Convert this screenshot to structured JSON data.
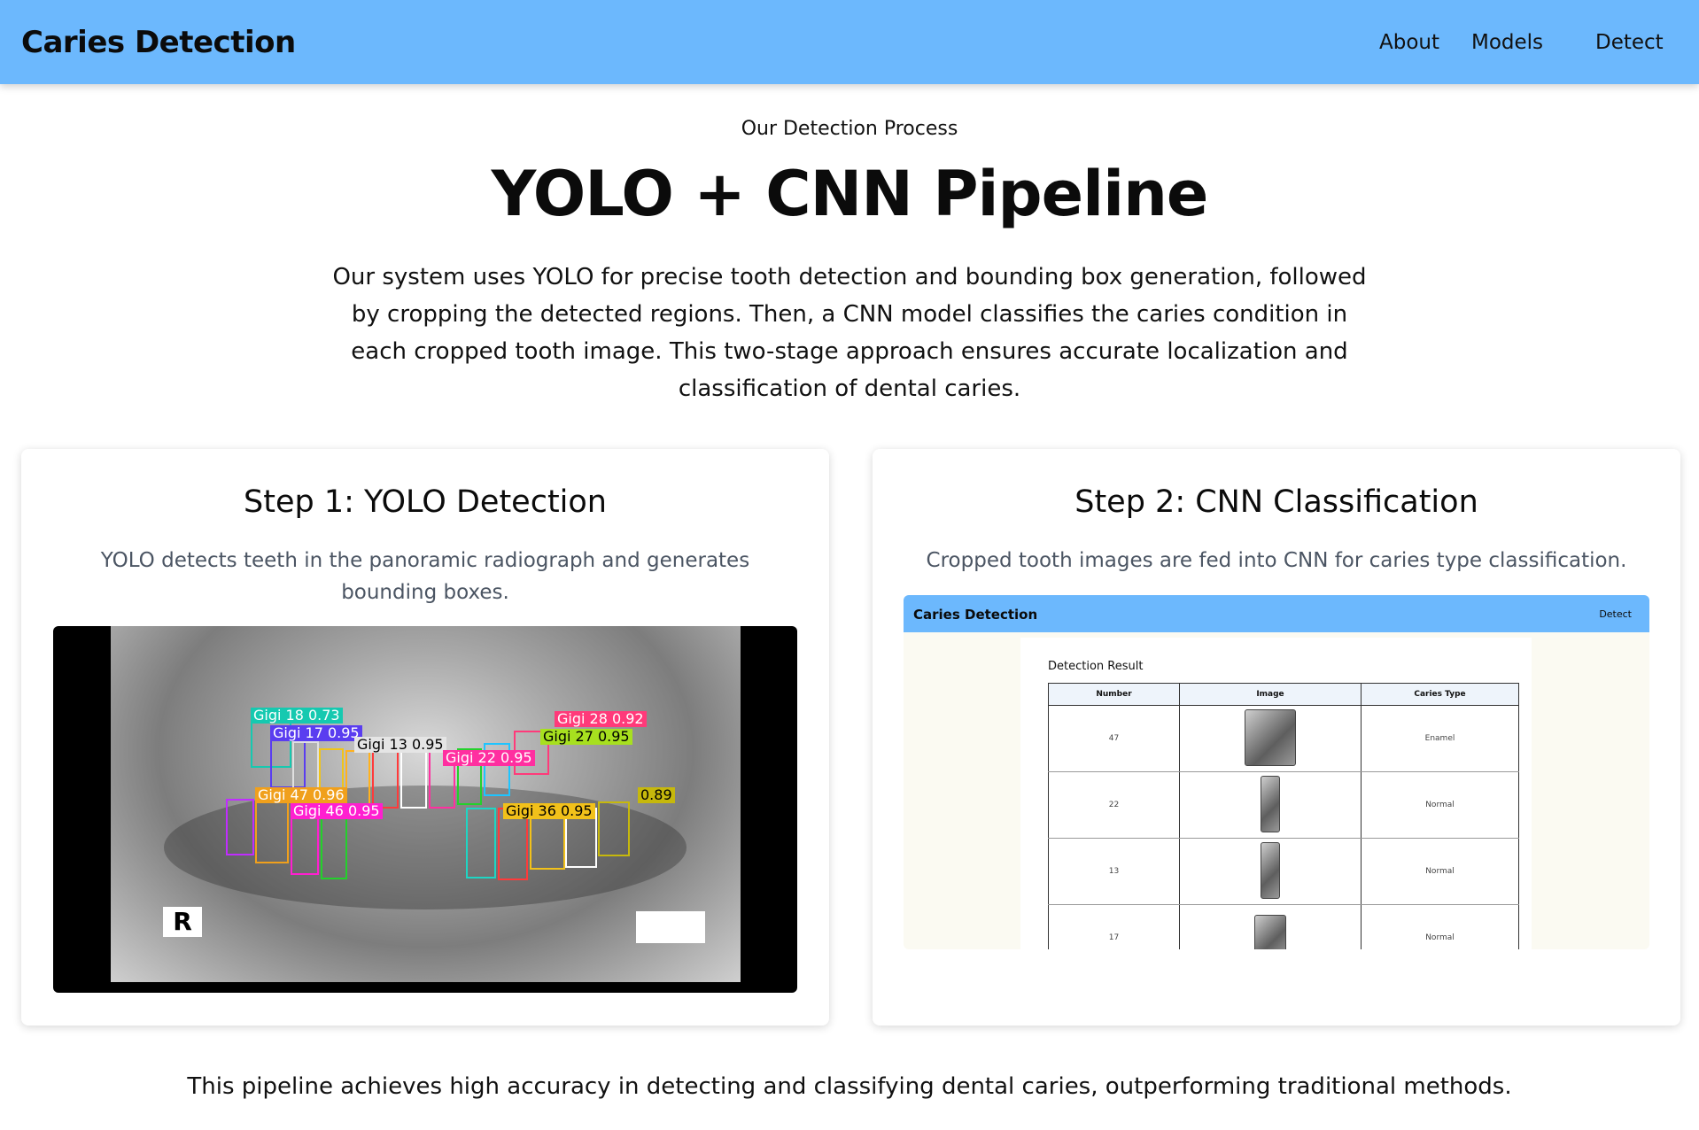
{
  "nav": {
    "brand": "Caries Detection",
    "links": [
      "About",
      "Models",
      "Detect"
    ]
  },
  "hero": {
    "eyebrow": "Our Detection Process",
    "title": "YOLO + CNN Pipeline",
    "intro": "Our system uses YOLO for precise tooth detection and bounding box generation, followed by cropping the detected regions. Then, a CNN model classifies the caries condition in each cropped tooth image. This two-stage approach ensures accurate localization and classification of dental caries."
  },
  "steps": [
    {
      "title": "Step 1: YOLO Detection",
      "description": "YOLO detects teeth in the panoramic radiograph and generates bounding boxes."
    },
    {
      "title": "Step 2: CNN Classification",
      "description": "Cropped tooth images are fed into CNN for caries type classification."
    }
  ],
  "xray": {
    "marker": "R",
    "detections": [
      {
        "label": "Gigi 18 0.73",
        "color": "#16c9b0"
      },
      {
        "label": "Gigi 17 0.95",
        "color": "#5a3df0"
      },
      {
        "label": "Gigi 13 0.95",
        "color": "#c9c9c9"
      },
      {
        "label": "Gigi 22 0.95",
        "color": "#ff2fa0"
      },
      {
        "label": "Gigi 28 0.92",
        "color": "#ff3a7a"
      },
      {
        "label": "Gigi 27 0.95",
        "color": "#a7e01f"
      },
      {
        "label": "Gigi 47 0.96",
        "color": "#f0a01c"
      },
      {
        "label": "Gigi 46 0.95",
        "color": "#ff1fd0"
      },
      {
        "label": "Gigi 36 0.95",
        "color": "#f2c11a"
      },
      {
        "label": "0.89",
        "color": "#c6b80c"
      }
    ]
  },
  "screenshot": {
    "brand": "Caries Detection",
    "nav_detect": "Detect",
    "heading": "Detection Result",
    "columns": [
      "Number",
      "Image",
      "Caries Type"
    ],
    "rows": [
      {
        "number": "47",
        "type": "Enamel"
      },
      {
        "number": "22",
        "type": "Normal"
      },
      {
        "number": "13",
        "type": "Normal"
      },
      {
        "number": "17",
        "type": "Normal"
      }
    ]
  },
  "footer": "This pipeline achieves high accuracy in detecting and classifying dental caries, outperforming traditional methods."
}
